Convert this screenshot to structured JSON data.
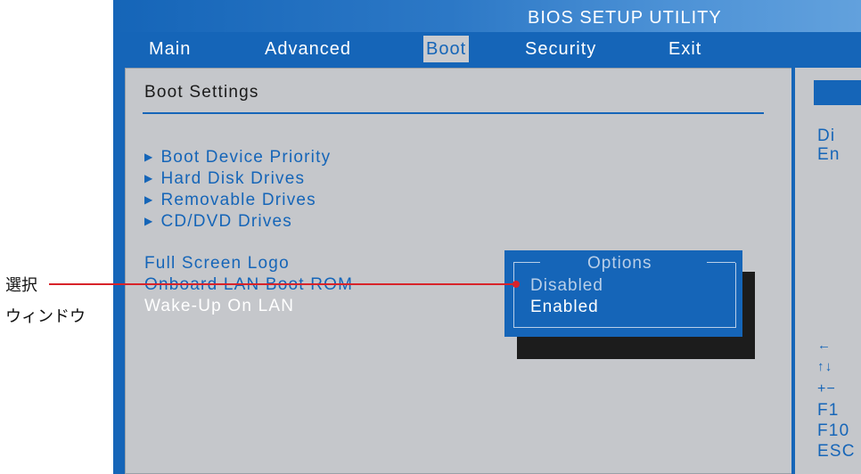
{
  "bios": {
    "title": "BIOS SETUP UTILITY",
    "menu": [
      "Main",
      "Advanced",
      "Boot",
      "Security",
      "Exit"
    ],
    "selected_menu": "Boot"
  },
  "panel": {
    "heading": "Boot Settings",
    "submenus": [
      "Boot Device Priority",
      "Hard Disk Drives",
      "Removable Drives",
      "CD/DVD Drives"
    ],
    "settings": [
      "Full Screen Logo",
      "Onboard LAN Boot ROM",
      "Wake-Up On LAN"
    ]
  },
  "popup": {
    "title": "Options",
    "options": [
      "Disabled",
      "Enabled"
    ],
    "highlighted": "Enabled"
  },
  "help": {
    "lines": [
      "Di",
      "En"
    ],
    "keys": [
      "←",
      "↑↓",
      "+−",
      "F1",
      "F10",
      "ESC"
    ]
  },
  "callout": {
    "line1": "選択",
    "line2": "ウィンドウ",
    "color": "#d8232a"
  },
  "colors": {
    "bios_blue": "#1565b8",
    "panel_gray": "#c5c7cb"
  }
}
